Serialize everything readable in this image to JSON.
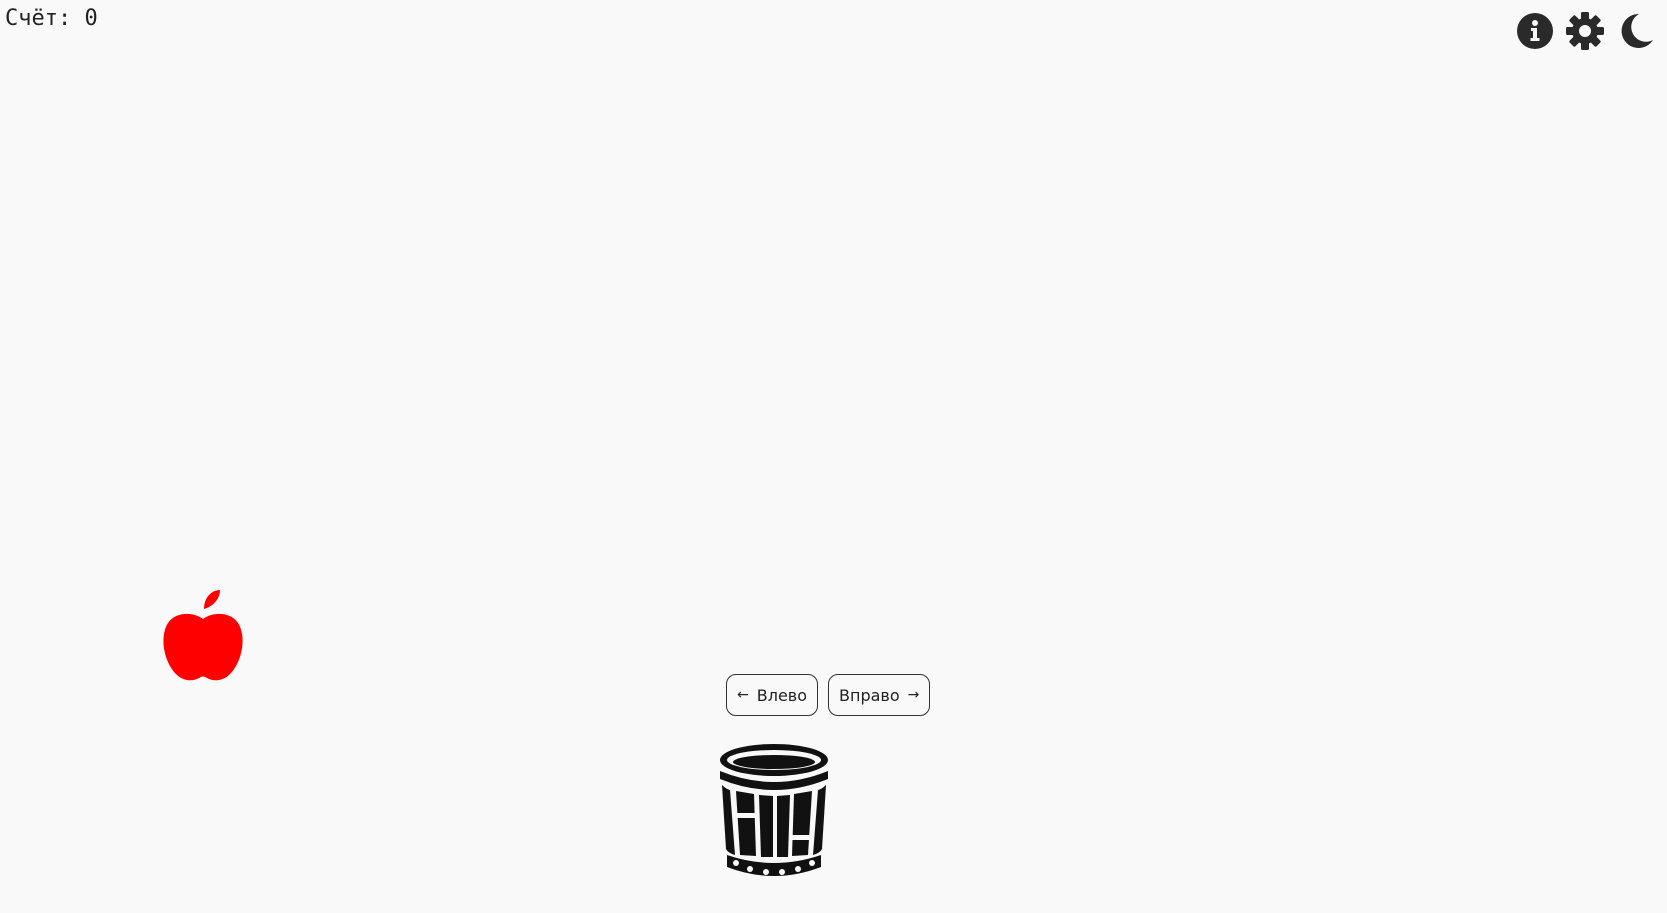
{
  "score": {
    "text": "Счёт: 0"
  },
  "toolbar": {
    "icons": [
      "info-icon",
      "gear-icon",
      "moon-icon"
    ]
  },
  "game": {
    "apple_color": "#ff0000",
    "basket_color": "#111111"
  },
  "controls": {
    "left_label": "Влево",
    "left_arrow": "←",
    "right_label": "Вправо",
    "right_arrow": "→"
  }
}
